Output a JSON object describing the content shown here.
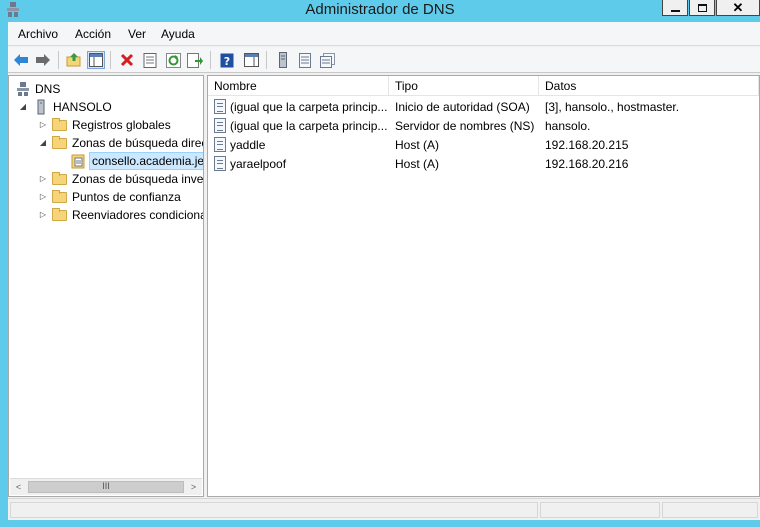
{
  "window": {
    "title": "Administrador de DNS"
  },
  "menu": [
    "Archivo",
    "Acción",
    "Ver",
    "Ayuda"
  ],
  "toolbar_icons": [
    "back-arrow-icon",
    "forward-arrow-icon",
    "up-folder-icon",
    "show-hide-tree-icon",
    "delete-icon",
    "properties-icon",
    "refresh-icon",
    "export-list-icon",
    "help-icon",
    "action-pane-icon",
    "server-icon",
    "records-icon",
    "copy-records-icon"
  ],
  "tree": {
    "root": "DNS",
    "server": "HANSOLO",
    "items": [
      "Registros globales",
      "Zonas de búsqueda direc",
      "consello.academia.je",
      "Zonas de búsqueda inver",
      "Puntos de confianza",
      "Reenviadores condiciona"
    ]
  },
  "scrollbar": {
    "left": "<",
    "right": ">",
    "grip": "III"
  },
  "list": {
    "columns": [
      "Nombre",
      "Tipo",
      "Datos"
    ],
    "rows": [
      {
        "name": "(igual que la carpeta princip...",
        "type": "Inicio de autoridad (SOA)",
        "data": "[3], hansolo., hostmaster."
      },
      {
        "name": "(igual que la carpeta princip...",
        "type": "Servidor de nombres (NS)",
        "data": "hansolo."
      },
      {
        "name": "yaddle",
        "type": "Host (A)",
        "data": "192.168.20.215"
      },
      {
        "name": "yaraelpoof",
        "type": "Host (A)",
        "data": "192.168.20.216"
      }
    ]
  },
  "colors": {
    "window_frame": "#5fcbea",
    "selection": "#cce8ff"
  }
}
